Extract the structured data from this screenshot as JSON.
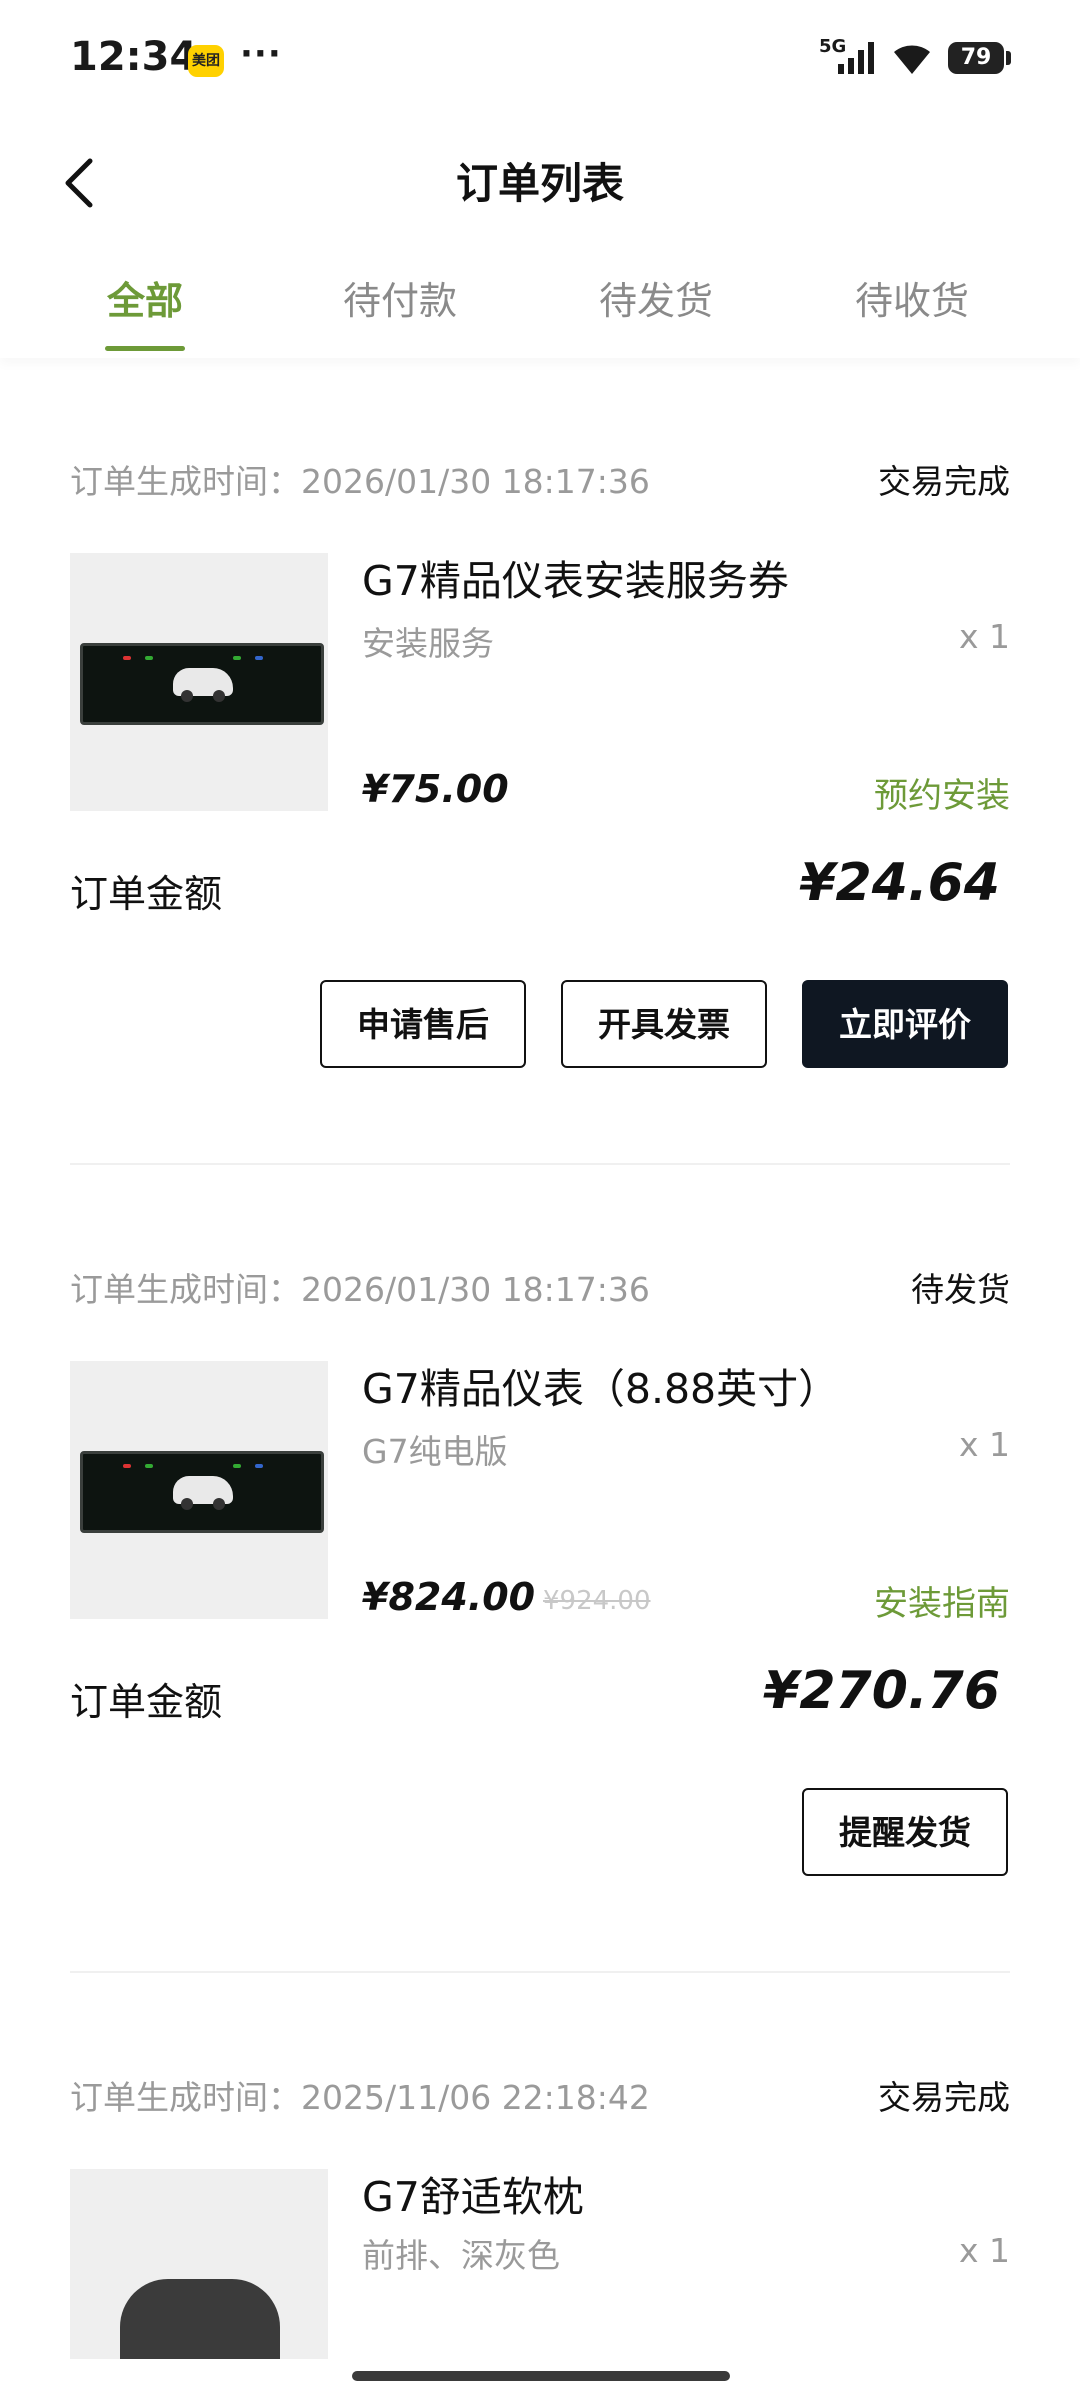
{
  "status_bar": {
    "time": "12:34",
    "app_badge": "美团",
    "more": "···",
    "network": "5G",
    "battery": "79"
  },
  "nav": {
    "title": "订单列表"
  },
  "tabs": [
    {
      "label": "全部",
      "active": true
    },
    {
      "label": "待付款",
      "active": false
    },
    {
      "label": "待发货",
      "active": false
    },
    {
      "label": "待收货",
      "active": false
    }
  ],
  "orders": [
    {
      "time_label": "订单生成时间：2026/01/30 18:17:36",
      "status": "交易完成",
      "product_name": "G7精品仪表安装服务券",
      "product_spec": "安装服务",
      "quantity": "x 1",
      "price": "¥75.00",
      "action_link": "预约安装",
      "total_label": "订单金额",
      "total_value": "¥24.64",
      "buttons": [
        "申请售后",
        "开具发票",
        "立即评价"
      ]
    },
    {
      "time_label": "订单生成时间：2026/01/30 18:17:36",
      "status": "待发货",
      "product_name": "G7精品仪表（8.88英寸）",
      "product_spec": "G7纯电版",
      "quantity": "x 1",
      "price": "¥824.00",
      "original_price": "¥924.00",
      "action_link": "安装指南",
      "total_label": "订单金额",
      "total_value": "¥270.76",
      "buttons": [
        "提醒发货"
      ]
    },
    {
      "time_label": "订单生成时间：2025/11/06 22:18:42",
      "status": "交易完成",
      "product_name": "G7舒适软枕",
      "product_spec": "前排、深灰色",
      "quantity": "x 1"
    }
  ],
  "colors": {
    "accent": "#6d9a38",
    "primary_button": "#0f1722",
    "muted_text": "#9a9a9a"
  }
}
